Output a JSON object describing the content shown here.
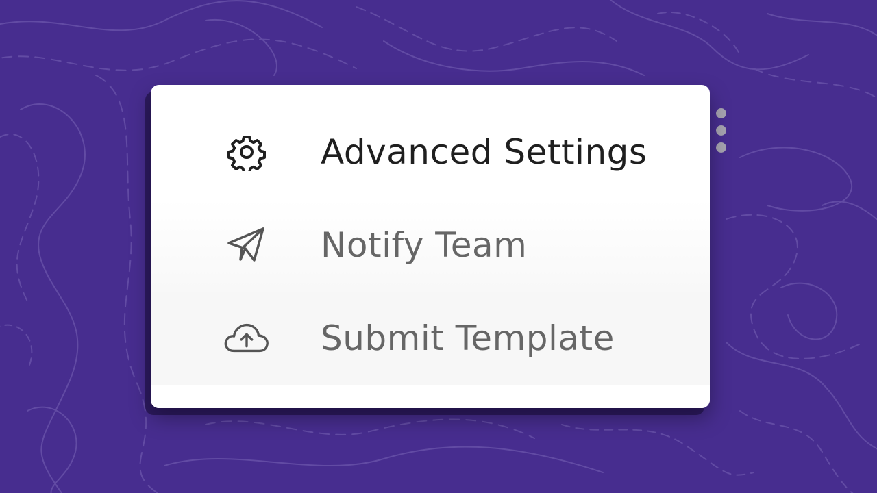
{
  "colors": {
    "background": "#472d8f",
    "card": "#ffffff",
    "active_text": "#1f1f1f",
    "inactive_text": "#666666"
  },
  "menu": {
    "items": [
      {
        "label": "Advanced Settings",
        "icon": "gear-icon"
      },
      {
        "label": "Notify Team",
        "icon": "paper-plane-icon"
      },
      {
        "label": "Submit Template",
        "icon": "cloud-upload-icon"
      }
    ]
  },
  "more_button": {
    "icon": "more-vertical-icon"
  }
}
